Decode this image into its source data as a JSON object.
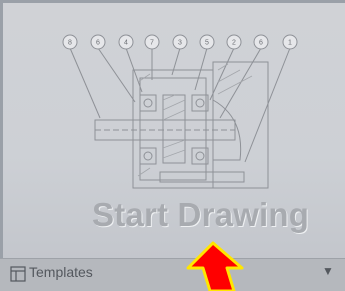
{
  "tile": {
    "title": "Start Drawing",
    "balloons": [
      "8",
      "6",
      "4",
      "7",
      "3",
      "5",
      "2",
      "6",
      "1"
    ]
  },
  "footer": {
    "templates_label": "Templates",
    "dropdown_glyph": "▼"
  },
  "icons": {
    "templates": "templates-icon",
    "chevron": "chevron-down-icon",
    "annotation_arrow": "red-arrow-icon"
  },
  "colors": {
    "tile_bg": "#cdd0d5",
    "title": "#a8abb0",
    "footer_bg": "#b5b8bd",
    "arrow_fill": "#ff0000",
    "arrow_outline": "#ffe600"
  }
}
